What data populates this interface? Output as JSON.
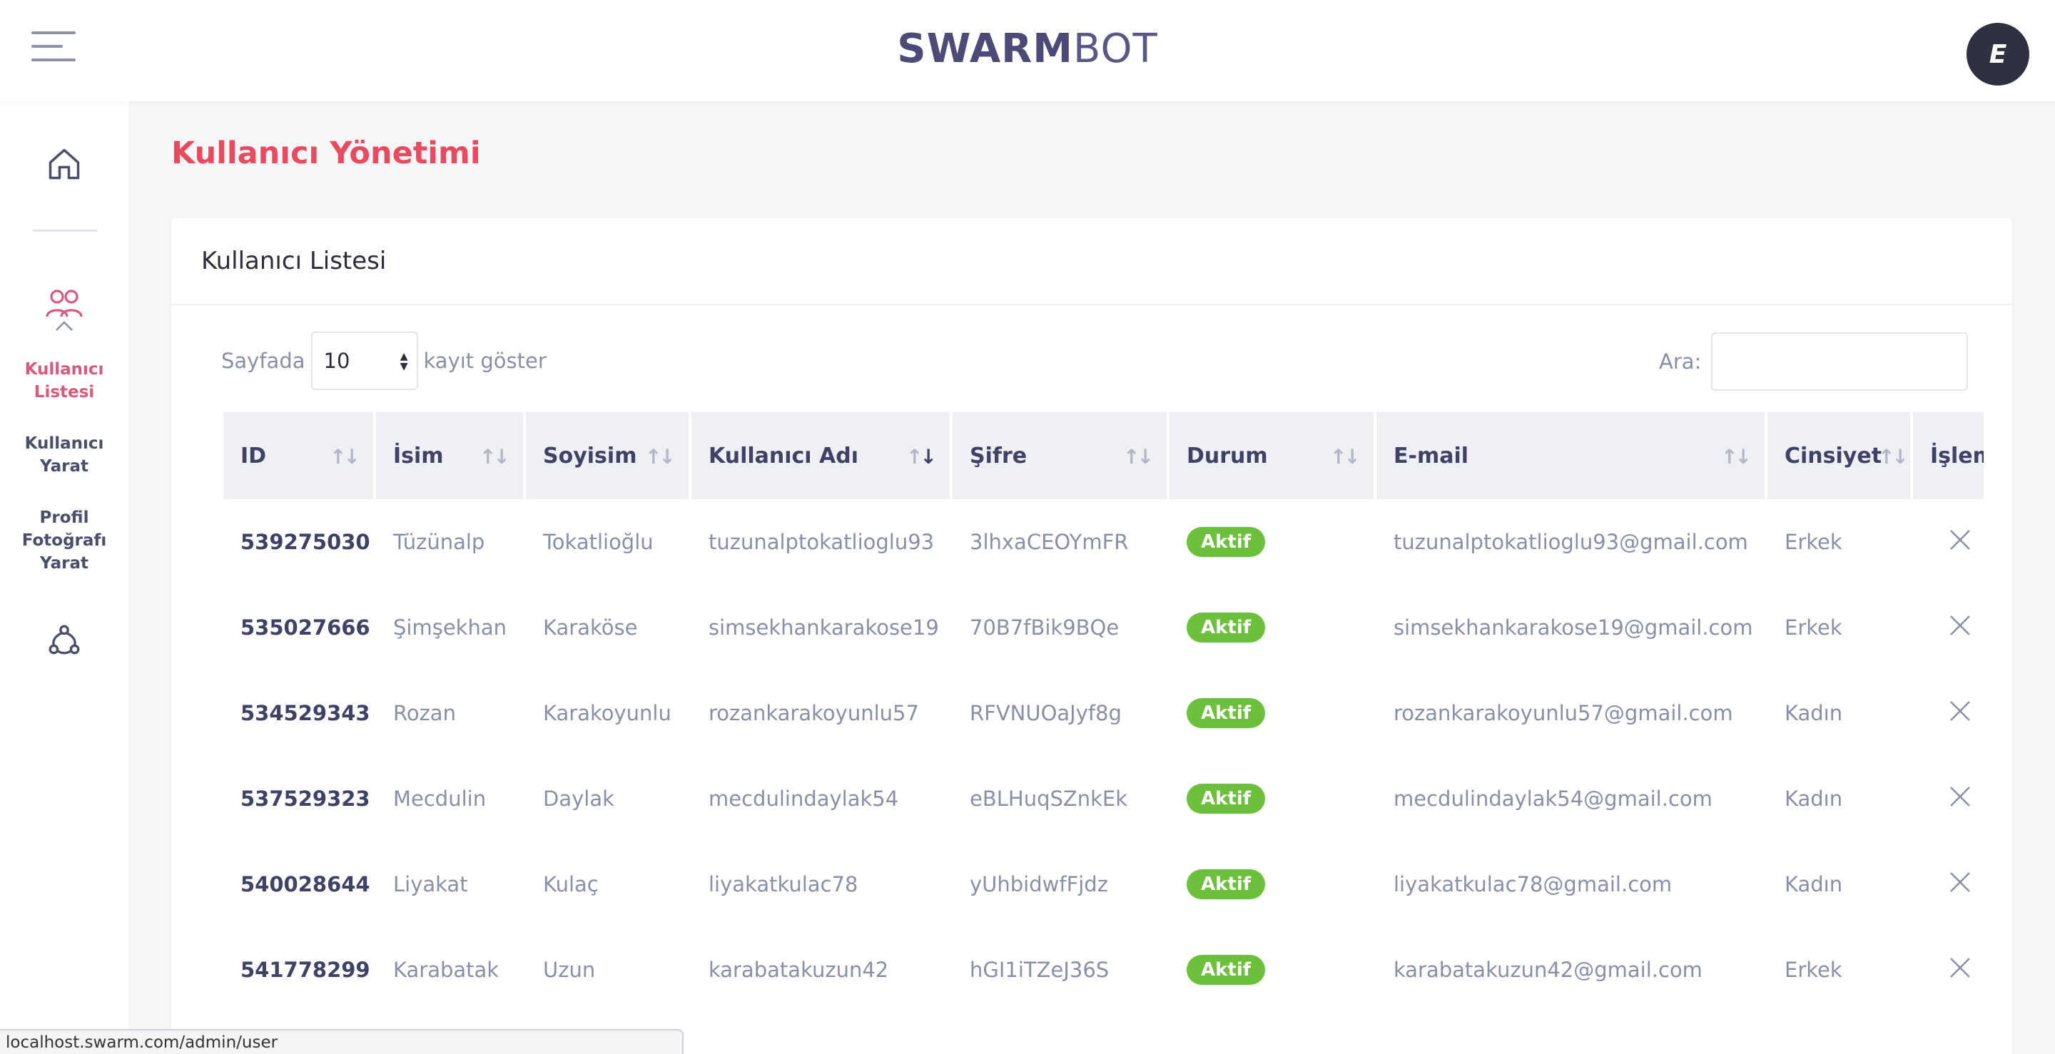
{
  "header": {
    "logo_bold": "SWARM",
    "logo_light": "BOT",
    "avatar_initial": "E"
  },
  "sidebar": {
    "items": [
      {
        "label": "Kullanıcı Listesi",
        "line1": "Kullanıcı",
        "line2": "Listesi",
        "active": true
      },
      {
        "label": "Kullanıcı Yarat",
        "line1": "Kullanıcı",
        "line2": "Yarat"
      },
      {
        "label": "Profil Fotoğrafı Yarat",
        "line1": "Profil",
        "line2": "Fotoğrafı",
        "line3": "Yarat"
      }
    ],
    "icons": [
      "home-icon",
      "users-icon",
      "chevron-up-icon",
      "share-icon"
    ]
  },
  "page": {
    "title": "Kullanıcı Yönetimi"
  },
  "card": {
    "title": "Kullanıcı Listesi",
    "length_prefix": "Sayfada",
    "length_value": "10",
    "length_suffix": "kayıt göster",
    "search_label": "Ara:",
    "search_value": ""
  },
  "table": {
    "columns": [
      "ID",
      "İsim",
      "Soyisim",
      "Kullanıcı Adı",
      "Şifre",
      "Durum",
      "E-mail",
      "Cinsiyet",
      "İşlem"
    ],
    "rows": [
      {
        "id": "539275030",
        "name": "Tüzünalp",
        "surname": "Tokatlioğlu",
        "username": "tuzunalptokatlioglu93",
        "password": "3lhxaCEOYmFR",
        "status": "Aktif",
        "email": "tuzunalptokatlioglu93@gmail.com",
        "gender": "Erkek"
      },
      {
        "id": "535027666",
        "name": "Şimşekhan",
        "surname": "Karaköse",
        "username": "simsekhankarakose19",
        "password": "70B7fBik9BQe",
        "status": "Aktif",
        "email": "simsekhankarakose19@gmail.com",
        "gender": "Erkek"
      },
      {
        "id": "534529343",
        "name": "Rozan",
        "surname": "Karakoyunlu",
        "username": "rozankarakoyunlu57",
        "password": "RFVNUOaJyf8g",
        "status": "Aktif",
        "email": "rozankarakoyunlu57@gmail.com",
        "gender": "Kadın"
      },
      {
        "id": "537529323",
        "name": "Mecdulin",
        "surname": "Daylak",
        "username": "mecdulindaylak54",
        "password": "eBLHuqSZnkEk",
        "status": "Aktif",
        "email": "mecdulindaylak54@gmail.com",
        "gender": "Kadın"
      },
      {
        "id": "540028644",
        "name": "Liyakat",
        "surname": "Kulaç",
        "username": "liyakatkulac78",
        "password": "yUhbidwfFjdz",
        "status": "Aktif",
        "email": "liyakatkulac78@gmail.com",
        "gender": "Kadın"
      },
      {
        "id": "541778299",
        "name": "Karabatak",
        "surname": "Uzun",
        "username": "karabatakuzun42",
        "password": "hGI1iTZeJ36S",
        "status": "Aktif",
        "email": "karabatakuzun42@gmail.com",
        "gender": "Erkek"
      }
    ]
  },
  "statusbar": {
    "url": "localhost.swarm.com/admin/user"
  },
  "colors": {
    "accent": "#e84a5f",
    "active_nav": "#d65a7a",
    "badge": "#6cc03b",
    "header_text": "#3f4266"
  }
}
